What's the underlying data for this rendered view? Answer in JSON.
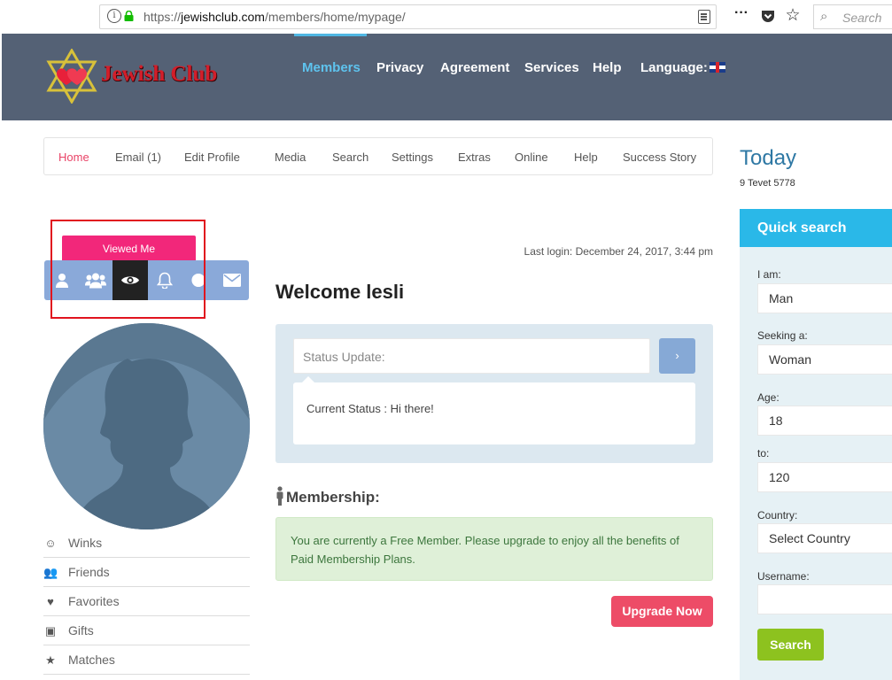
{
  "browser": {
    "url_prefix": "https://",
    "url_domain": "jewishclub.com",
    "url_path": "/members/home/mypage/",
    "search_placeholder": "Search"
  },
  "header": {
    "brand": "Jewish Club",
    "nav": [
      {
        "label": "Members"
      },
      {
        "label": "Privacy"
      },
      {
        "label": "Agreement"
      },
      {
        "label": "Services"
      },
      {
        "label": "Help"
      },
      {
        "label": "Language:"
      }
    ]
  },
  "subnav": [
    {
      "label": "Home"
    },
    {
      "label": "Email (1)"
    },
    {
      "label": "Edit Profile"
    },
    {
      "label": "Media"
    },
    {
      "label": "Search"
    },
    {
      "label": "Settings"
    },
    {
      "label": "Extras"
    },
    {
      "label": "Online"
    },
    {
      "label": "Help"
    },
    {
      "label": "Success Story"
    }
  ],
  "today": {
    "title": "Today",
    "hebrew_date": "9 Tevet 5778"
  },
  "quick_search": {
    "title": "Quick search",
    "i_am_label": "I am:",
    "i_am_value": "Man",
    "seeking_label": "Seeking a:",
    "seeking_value": "Woman",
    "age_label": "Age:",
    "age_from": "18",
    "to_label": "to:",
    "age_to": "120",
    "country_label": "Country:",
    "country_value": "Select Country",
    "username_label": "Username:",
    "username_value": "",
    "button": "Search"
  },
  "profile": {
    "tooltip": "Viewed Me",
    "icons": [
      "user-icon",
      "friends-icon",
      "eye-icon",
      "bell-icon",
      "circle-icon",
      "envelope-icon"
    ],
    "side_items": [
      {
        "label": "Winks",
        "icon": "smile-icon"
      },
      {
        "label": "Friends",
        "icon": "friends-icon"
      },
      {
        "label": "Favorites",
        "icon": "heart-icon"
      },
      {
        "label": "Gifts",
        "icon": "gift-icon"
      },
      {
        "label": "Matches",
        "icon": "star-icon"
      }
    ]
  },
  "main": {
    "last_login": "Last login: December 24, 2017, 3:44 pm",
    "welcome": "Welcome lesli",
    "status_placeholder": "Status Update:",
    "status_button": "›",
    "current_status": "Current Status : Hi there!",
    "membership_heading": "Membership:",
    "membership_notice": "You are currently a Free Member. Please upgrade to enjoy all the benefits of Paid Membership Plans.",
    "upgrade_button": "Upgrade Now"
  },
  "colors": {
    "header_bg": "#546175",
    "accent_blue": "#2ab8e8",
    "pink": "#f2277a",
    "upgrade": "#ed4c67",
    "search_green": "#8dc21f"
  }
}
